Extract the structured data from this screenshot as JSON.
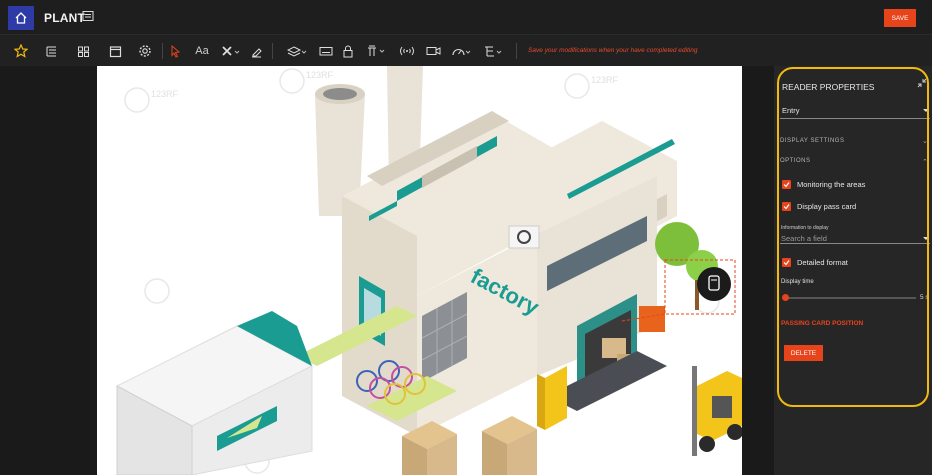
{
  "app": {
    "title": "PLANT"
  },
  "header": {
    "save_label": "SAVE"
  },
  "toolbar": {
    "font_label": "Aa",
    "hint": "Save your modifications when your have completed editing",
    "icons": [
      "star-icon",
      "tree-list-icon",
      "grid-icon",
      "window-icon",
      "settings-icon",
      "pointer-icon",
      "text-icon",
      "cross-tool-icon",
      "eraser-icon",
      "layers-icon",
      "keyboard-icon",
      "lock-icon",
      "badge-reader-icon",
      "wifi-signal-icon",
      "camera-icon",
      "gauge-icon",
      "stack-icon"
    ]
  },
  "canvas": {
    "factory_sign": "factory",
    "watermark": "123RF"
  },
  "panel": {
    "title": "READER PROPERTIES",
    "reader_type": "Entry",
    "display_settings": "DISPLAY SETTINGS",
    "options": "OPTIONS",
    "monitoring_areas": "Monitoring the areas",
    "display_pass_card": "Display pass card",
    "info_label": "Information to display",
    "info_placeholder": "Search a field",
    "detailed_format": "Detailed format",
    "display_time_label": "Display time",
    "display_time_value": "5 s",
    "display_time_level": 0,
    "passing_card_position": "PASSING CARD POSITION",
    "delete_label": "DELETE"
  },
  "colors": {
    "accent": "#e8441c",
    "home": "#2e3ba6",
    "highlight": "#f2b90f",
    "teal": "#1a9c93"
  }
}
